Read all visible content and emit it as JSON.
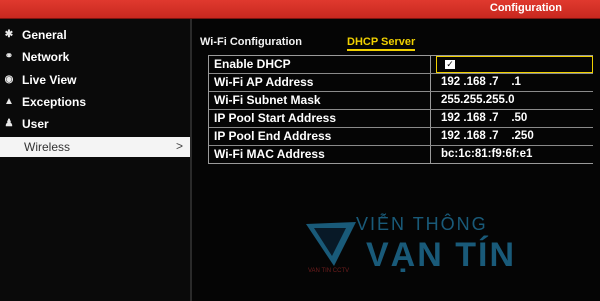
{
  "window": {
    "title": "Configuration"
  },
  "sidebar": {
    "items": [
      {
        "label": "General",
        "icon": "gear-icon"
      },
      {
        "label": "Network",
        "icon": "network-icon"
      },
      {
        "label": "Live View",
        "icon": "eye-icon"
      },
      {
        "label": "Exceptions",
        "icon": "warning-icon"
      },
      {
        "label": "User",
        "icon": "user-icon"
      },
      {
        "label": "Wireless",
        "selected": true,
        "chevron": ">"
      }
    ]
  },
  "tabs": [
    {
      "label": "Wi-Fi Configuration",
      "active": false
    },
    {
      "label": "DHCP Server",
      "active": true
    }
  ],
  "form": {
    "enable_dhcp": {
      "label": "Enable DHCP",
      "checked": true,
      "check_glyph": "✓"
    },
    "wifi_ap_address": {
      "label": "Wi-Fi AP Address",
      "value": "192 .168 .7    .1"
    },
    "wifi_subnet_mask": {
      "label": "Wi-Fi Subnet Mask",
      "value": "255.255.255.0"
    },
    "ip_pool_start": {
      "label": "IP Pool Start Address",
      "value": "192 .168 .7    .50"
    },
    "ip_pool_end": {
      "label": "IP Pool End Address",
      "value": "192 .168 .7    .250"
    },
    "wifi_mac": {
      "label": "Wi-Fi MAC Address",
      "value": "bc:1c:81:f9:6f:e1"
    }
  },
  "watermark": {
    "line1": "VIỄN THÔNG",
    "line2": "VẠN TÍN",
    "small": "VAN TIN CCTV"
  },
  "colors": {
    "title_bar": "#d0302a",
    "tab_active": "#f0d000",
    "watermark": "#2aa0d8"
  }
}
